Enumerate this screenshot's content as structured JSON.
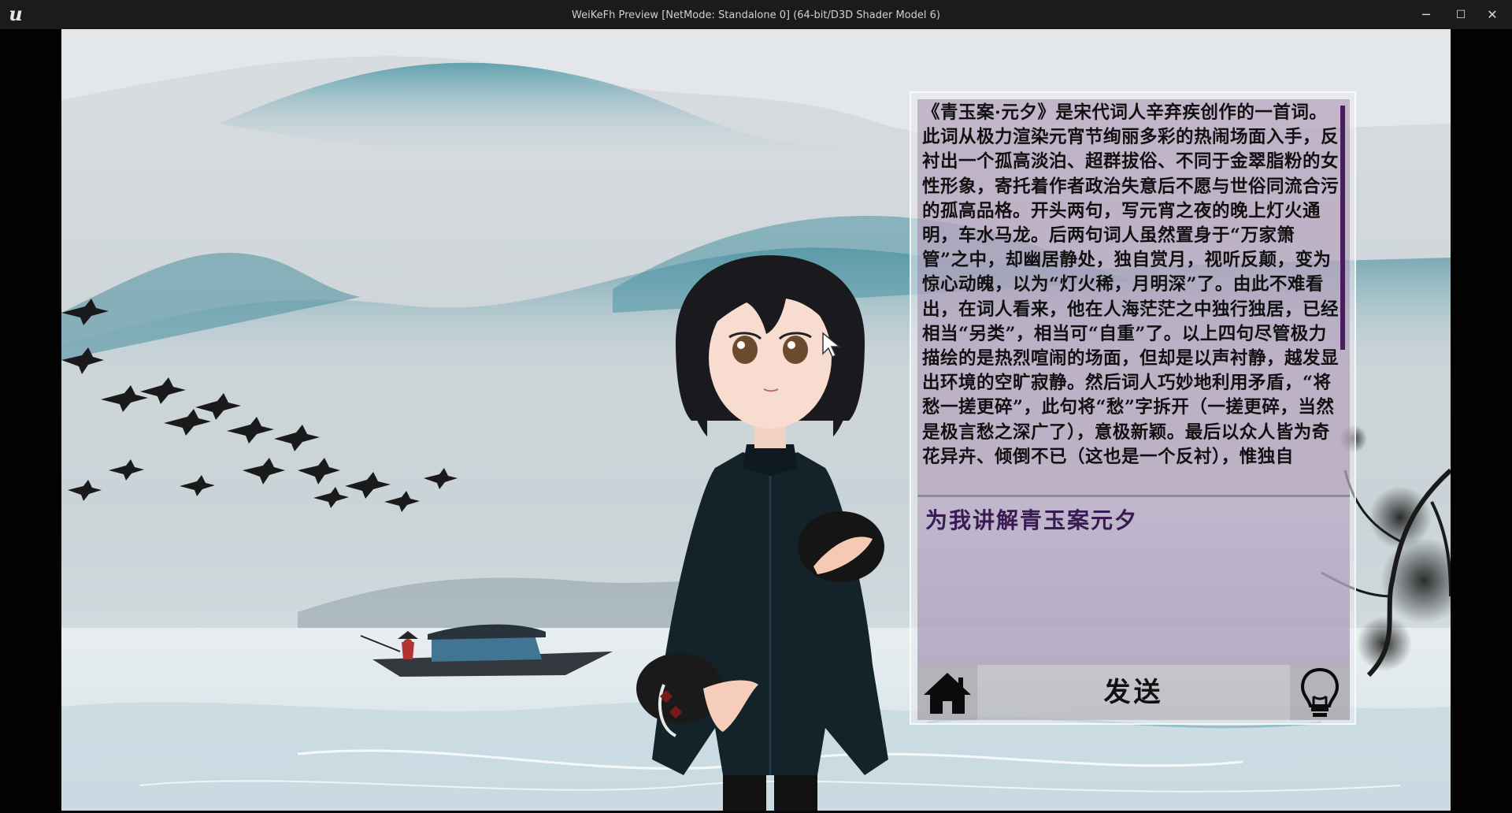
{
  "window": {
    "title": "WeiKeFh Preview [NetMode: Standalone 0]  (64-bit/D3D Shader Model 6)",
    "logo_text": "u",
    "minimize_icon": "─",
    "maximize_icon": "☐",
    "close_icon": "✕"
  },
  "chat": {
    "answer": "《青玉案·元夕》是宋代词人辛弃疾创作的一首词。此词从极力渲染元宵节绚丽多彩的热闹场面入手，反衬出一个孤高淡泊、超群拔俗、不同于金翠脂粉的女性形象，寄托着作者政治失意后不愿与世俗同流合污的孤高品格。开头两句，写元宵之夜的晚上灯火通明，车水马龙。后两句词人虽然置身于“万家箫管”之中，却幽居静处，独自赏月，视听反颠，变为惊心动魄，以为“灯火稀，月明深”了。由此不难看出，在词人看来，他在人海茫茫之中独行独居，已经相当“另类”，相当可“自重”了。以上四句尽管极力描绘的是热烈喧闹的场面，但却是以声衬静，越发显出环境的空旷寂静。然后词人巧妙地利用矛盾，“将愁一搓更碎”，此句将“愁”字拆开（一搓更碎，当然是极言愁之深广了），意极新颖。最后以众人皆为奇花异卉、倾倒不已（这也是一个反衬），惟独自",
    "input_value": "为我讲解青玉案元夕",
    "send_label": "发送",
    "home_icon": "home-icon",
    "hint_icon": "lightbulb-icon"
  },
  "colors": {
    "accent_purple": "#4a1d5e",
    "input_text": "#3a1a52",
    "titlebar": "#1b1b1b"
  }
}
